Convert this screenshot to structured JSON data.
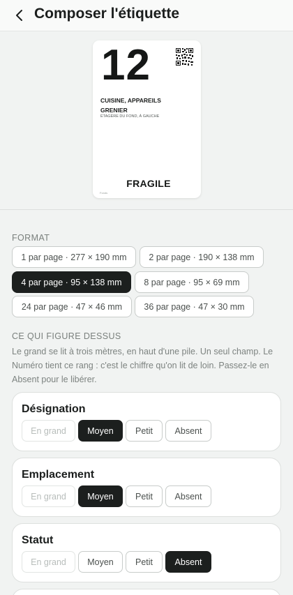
{
  "header": {
    "title": "Composer l'étiquette"
  },
  "preview": {
    "number": "12",
    "designation": "CUISINE, APPAREILS",
    "location": "GRENIER",
    "detail": "ÉTAGÈRE DU FOND, À GAUCHE",
    "status": "FRAGILE",
    "brand": "Fonds"
  },
  "format": {
    "heading": "FORMAT",
    "options": [
      {
        "label": "1 par page · 277 × 190 mm",
        "selected": false
      },
      {
        "label": "2 par page · 190 × 138 mm",
        "selected": false
      },
      {
        "label": "4 par page · 95 × 138 mm",
        "selected": true
      },
      {
        "label": "8 par page · 95 × 69 mm",
        "selected": false
      },
      {
        "label": "24 par page · 47 × 46 mm",
        "selected": false
      },
      {
        "label": "36 par page · 47 × 30 mm",
        "selected": false
      }
    ]
  },
  "content": {
    "heading": "CE QUI FIGURE DESSUS",
    "help": "Le grand se lit à trois mètres, en haut d'une pile. Un seul champ. Le Numéro tient ce rang : c'est le chiffre qu'on lit de loin. Passez-le en Absent pour le libérer."
  },
  "size_options": [
    "En grand",
    "Moyen",
    "Petit",
    "Absent"
  ],
  "fields": [
    {
      "title": "Désignation",
      "selected": "Moyen",
      "disabled": [
        "En grand"
      ]
    },
    {
      "title": "Emplacement",
      "selected": "Moyen",
      "disabled": [
        "En grand"
      ]
    },
    {
      "title": "Statut",
      "selected": "Absent",
      "disabled": [
        "En grand"
      ]
    }
  ]
}
